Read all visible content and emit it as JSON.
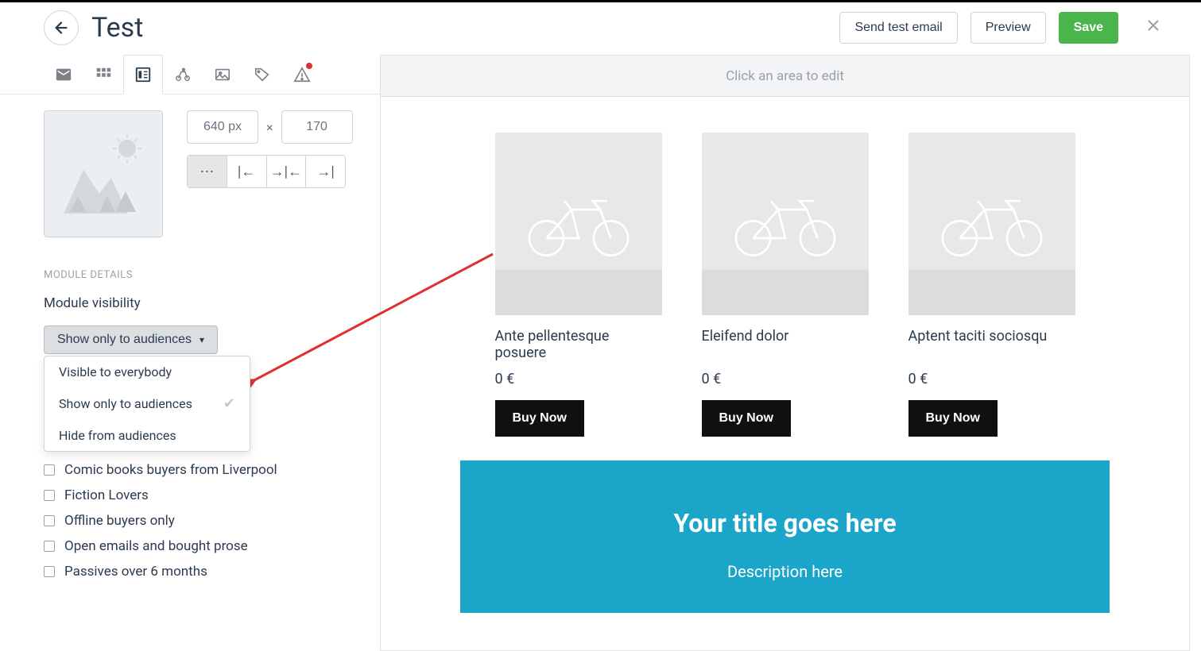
{
  "header": {
    "title": "Test",
    "send_test": "Send test email",
    "preview": "Preview",
    "save": "Save"
  },
  "sidebar": {
    "dimensions": {
      "width": "640 px",
      "height": "170"
    },
    "section_label": "MODULE DETAILS",
    "visibility_label": "Module visibility",
    "dropdown_label": "Show only to audiences",
    "dropdown_options": [
      {
        "label": "Visible to everybody",
        "selected": false
      },
      {
        "label": "Show only to audiences",
        "selected": true
      },
      {
        "label": "Hide from audiences",
        "selected": false
      }
    ],
    "audiences": [
      "Comic books buyers from Liverpool",
      "Fiction Lovers",
      "Offline buyers only",
      "Open emails and bought prose",
      "Passives over 6 months"
    ]
  },
  "canvas": {
    "hint": "Click an area to edit",
    "products": [
      {
        "title": "Ante pellentesque posuere",
        "price": "0 €",
        "cta": "Buy Now"
      },
      {
        "title": "Eleifend dolor",
        "price": "0 €",
        "cta": "Buy Now"
      },
      {
        "title": "Aptent taciti sociosqu",
        "price": "0 €",
        "cta": "Buy Now"
      }
    ],
    "hero": {
      "title": "Your title goes here",
      "description": "Description here"
    }
  }
}
